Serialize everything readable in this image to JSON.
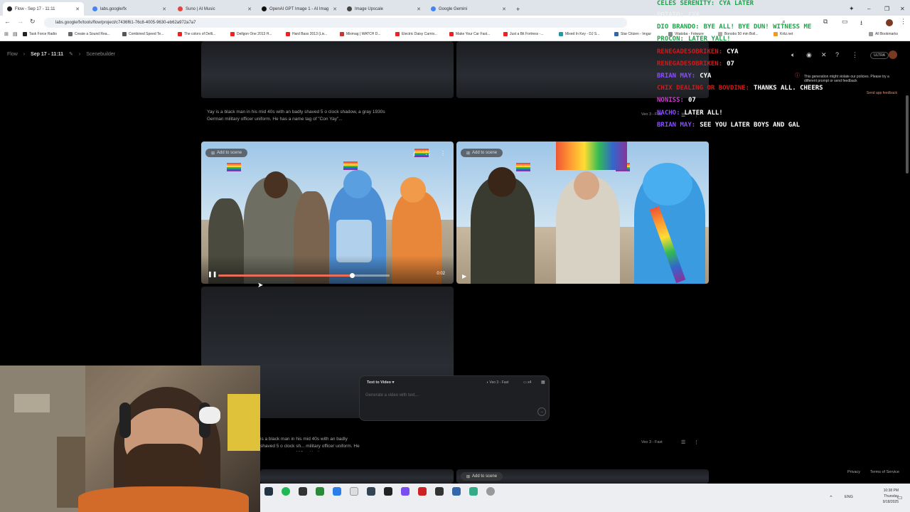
{
  "browser": {
    "tabs": [
      {
        "title": "Flow - Sep 17 - 11:11",
        "active": true,
        "color": "#222222"
      },
      {
        "title": "labs.google/fx",
        "active": false,
        "color": "#4285f4"
      },
      {
        "title": "Suno | AI Music",
        "active": false,
        "color": "#e8453c"
      },
      {
        "title": "OpenAI GPT Image 1 - AI Imag",
        "active": false,
        "color": "#111111"
      },
      {
        "title": "Image Upscale",
        "active": false,
        "color": "#444444"
      },
      {
        "title": "Google Gemini",
        "active": false,
        "color": "#4285f4"
      }
    ],
    "new_tab": "+",
    "url": "labs.google/fx/tools/flow/project/c7436f61-76c8-4005-9630-eb62a972a7a7",
    "bookmarks": [
      "Task Force Radio",
      "Create a Sound Rea...",
      "Combined Speed Te...",
      "The colors of Delli...",
      "Dellgon One 2013 H...",
      "Hard Bass 2013 (Liv...",
      "Mixmag | WATCH D...",
      "Electric Daisy Carniv...",
      "Make Your Car Fast...",
      "Just a Bit Fortress -...",
      "Mixed In Key - DJ S...",
      "Star Citizen - Imgur",
      "Vitatoba - Fotwure",
      "Bonobo 50 min Boil...",
      "Kritz.net"
    ],
    "all_bookmarks": "All Bookmarks"
  },
  "app": {
    "breadcrumb": {
      "root": "Flow",
      "project": "Sep 17 - 11:11",
      "section": "Scenebuilder"
    },
    "plan_badge": "ULTRA",
    "policy_notice": "This generation might violate our policies. Please try a different prompt or send feedback",
    "send_feedback": "Send app feedback",
    "prompt_top": "Yay is a black man in his mid 40s with an badly shaved 5 o clock shadow, a gray 1930s German military officer uniform. He has a name tag of \"Con Yay\"...",
    "prompt_bottom": "is a black man in his mid 40s with an badly shaved 5 o clock sh... military officer uniform. He has a name tag of \"Con Yay\"...",
    "model_label": "Veo 3 - Fast",
    "add_to_scene": "Add to scene",
    "timestamp": "0:02",
    "progress": 0.78,
    "composer": {
      "mode": "Text to Video",
      "placeholder": "Generate a video with text...",
      "model": "Veo 3 - Fast",
      "count": "x4"
    },
    "footer": {
      "privacy": "Privacy",
      "terms": "Terms of Service"
    }
  },
  "chat": [
    {
      "user": "CELES SERENITY:",
      "msg": "CYA LATER",
      "color": "#1fa34a"
    },
    {
      "user": "POTATO:",
      "msg": "CYA",
      "color": "#eeeeee"
    },
    {
      "user": "DIO BRANDO:",
      "msg": "BYE ALL! BYE DUN! WITNESS ME",
      "color": "#1fa34a"
    },
    {
      "user": "PROCON:",
      "msg": "LATER YALL!",
      "color": "#1fa34a"
    },
    {
      "user": "RENEGADESOBRIKEN:",
      "msg": "CYA",
      "color": "#d11a1a"
    },
    {
      "user": "RENEGADESOBRIKEN:",
      "msg": "07",
      "color": "#d11a1a"
    },
    {
      "user": "BRIAN MAY:",
      "msg": "CYA",
      "color": "#8a4dff"
    },
    {
      "user": "CHIX DEALING OR BOVDINE:",
      "msg": "THANKS ALL. CHEERS",
      "color": "#d11a1a"
    },
    {
      "user": "NONISS:",
      "msg": "07",
      "color": "#d33ad3"
    },
    {
      "user": "NACHO:",
      "msg": "LATER ALL!",
      "color": "#8a4dff"
    },
    {
      "user": "BRIAN MAY:",
      "msg": "SEE YOU LATER BOYS AND GAL",
      "color": "#8a4dff"
    }
  ],
  "taskbar": {
    "lang": "ENG",
    "time": "10:38 PM",
    "day": "Thursday",
    "date": "9/18/2025"
  }
}
